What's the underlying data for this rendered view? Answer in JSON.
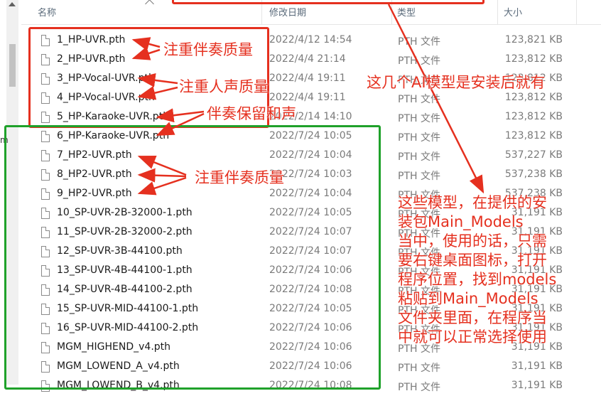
{
  "header": {
    "col_name": "名称",
    "col_date": "修改日期",
    "col_type": "类型",
    "col_size": "大小"
  },
  "stray_char": "m",
  "files": [
    {
      "name": "1_HP-UVR.pth",
      "date": "2022/4/12 14:54",
      "type": "PTH 文件",
      "size": "123,821 KB"
    },
    {
      "name": "2_HP-UVR.pth",
      "date": "2022/4/4 21:14",
      "type": "PTH 文件",
      "size": "123,812 KB"
    },
    {
      "name": "3_HP-Vocal-UVR.pth",
      "date": "2022/4/4 19:11",
      "type": "PTH 文件",
      "size": "123,812 KB"
    },
    {
      "name": "4_HP-Vocal-UVR.pth",
      "date": "2022/4/4 19:11",
      "type": "PTH 文件",
      "size": "123,812 KB"
    },
    {
      "name": "5_HP-Karaoke-UVR.pth",
      "date": "2022/2/14 14:10",
      "type": "PTH 文件",
      "size": "123,812 KB"
    },
    {
      "name": "6_HP-Karaoke-UVR.pth",
      "date": "2022/7/24 10:05",
      "type": "PTH 文件",
      "size": "123,812 KB"
    },
    {
      "name": "7_HP2-UVR.pth",
      "date": "2022/7/24 10:04",
      "type": "PTH 文件",
      "size": "537,227 KB"
    },
    {
      "name": "8_HP2-UVR.pth",
      "date": "2022/7/24 10:03",
      "type": "PTH 文件",
      "size": "537,238 KB"
    },
    {
      "name": "9_HP2-UVR.pth",
      "date": "2022/7/24 10:04",
      "type": "PTH 文件",
      "size": "537,238 KB"
    },
    {
      "name": "10_SP-UVR-2B-32000-1.pth",
      "date": "2022/7/24 10:05",
      "type": "PTH 文件",
      "size": "31,191 KB"
    },
    {
      "name": "11_SP-UVR-2B-32000-2.pth",
      "date": "2022/7/24 10:07",
      "type": "PTH 文件",
      "size": "31,191 KB"
    },
    {
      "name": "12_SP-UVR-3B-44100.pth",
      "date": "2022/7/24 10:07",
      "type": "PTH 文件",
      "size": "31,191 KB"
    },
    {
      "name": "13_SP-UVR-4B-44100-1.pth",
      "date": "2022/7/24 10:06",
      "type": "PTH 文件",
      "size": "31,191 KB"
    },
    {
      "name": "14_SP-UVR-4B-44100-2.pth",
      "date": "2022/7/24 10:08",
      "type": "PTH 文件",
      "size": "31,191 KB"
    },
    {
      "name": "15_SP-UVR-MID-44100-1.pth",
      "date": "2022/7/24 10:05",
      "type": "PTH 文件",
      "size": "31,191 KB"
    },
    {
      "name": "16_SP-UVR-MID-44100-2.pth",
      "date": "2022/7/24 10:06",
      "type": "PTH 文件",
      "size": "31,191 KB"
    },
    {
      "name": "MGM_HIGHEND_v4.pth",
      "date": "2022/7/24 10:06",
      "type": "PTH 文件",
      "size": "31,191 KB"
    },
    {
      "name": "MGM_LOWEND_A_v4.pth",
      "date": "2022/7/24 10:06",
      "type": "PTH 文件",
      "size": "31,191 KB"
    },
    {
      "name": "MGM_LOWEND_B_v4.pth",
      "date": "2022/7/24 10:08",
      "type": "PTH 文件",
      "size": "31,191 KB"
    }
  ],
  "annotations": {
    "a1": "注重伴奏质量",
    "a2": "注重人声质量",
    "a3": "伴奏保留和声",
    "a4": "注重伴奏质量",
    "a5": "这几个AI模型是安装后就有",
    "note_lines": [
      "这些模型，在提供的安",
      "装包Main_Models",
      "当中，使用的话，只需",
      "要右键桌面图标，打开",
      "程序位置，找到models",
      "粘贴到Main_Models",
      "文件夹里面，在程序当",
      "中就可以正常选择使用"
    ]
  },
  "colors": {
    "annotation_red": "#e5301f",
    "annotation_green": "#1fa12a"
  }
}
